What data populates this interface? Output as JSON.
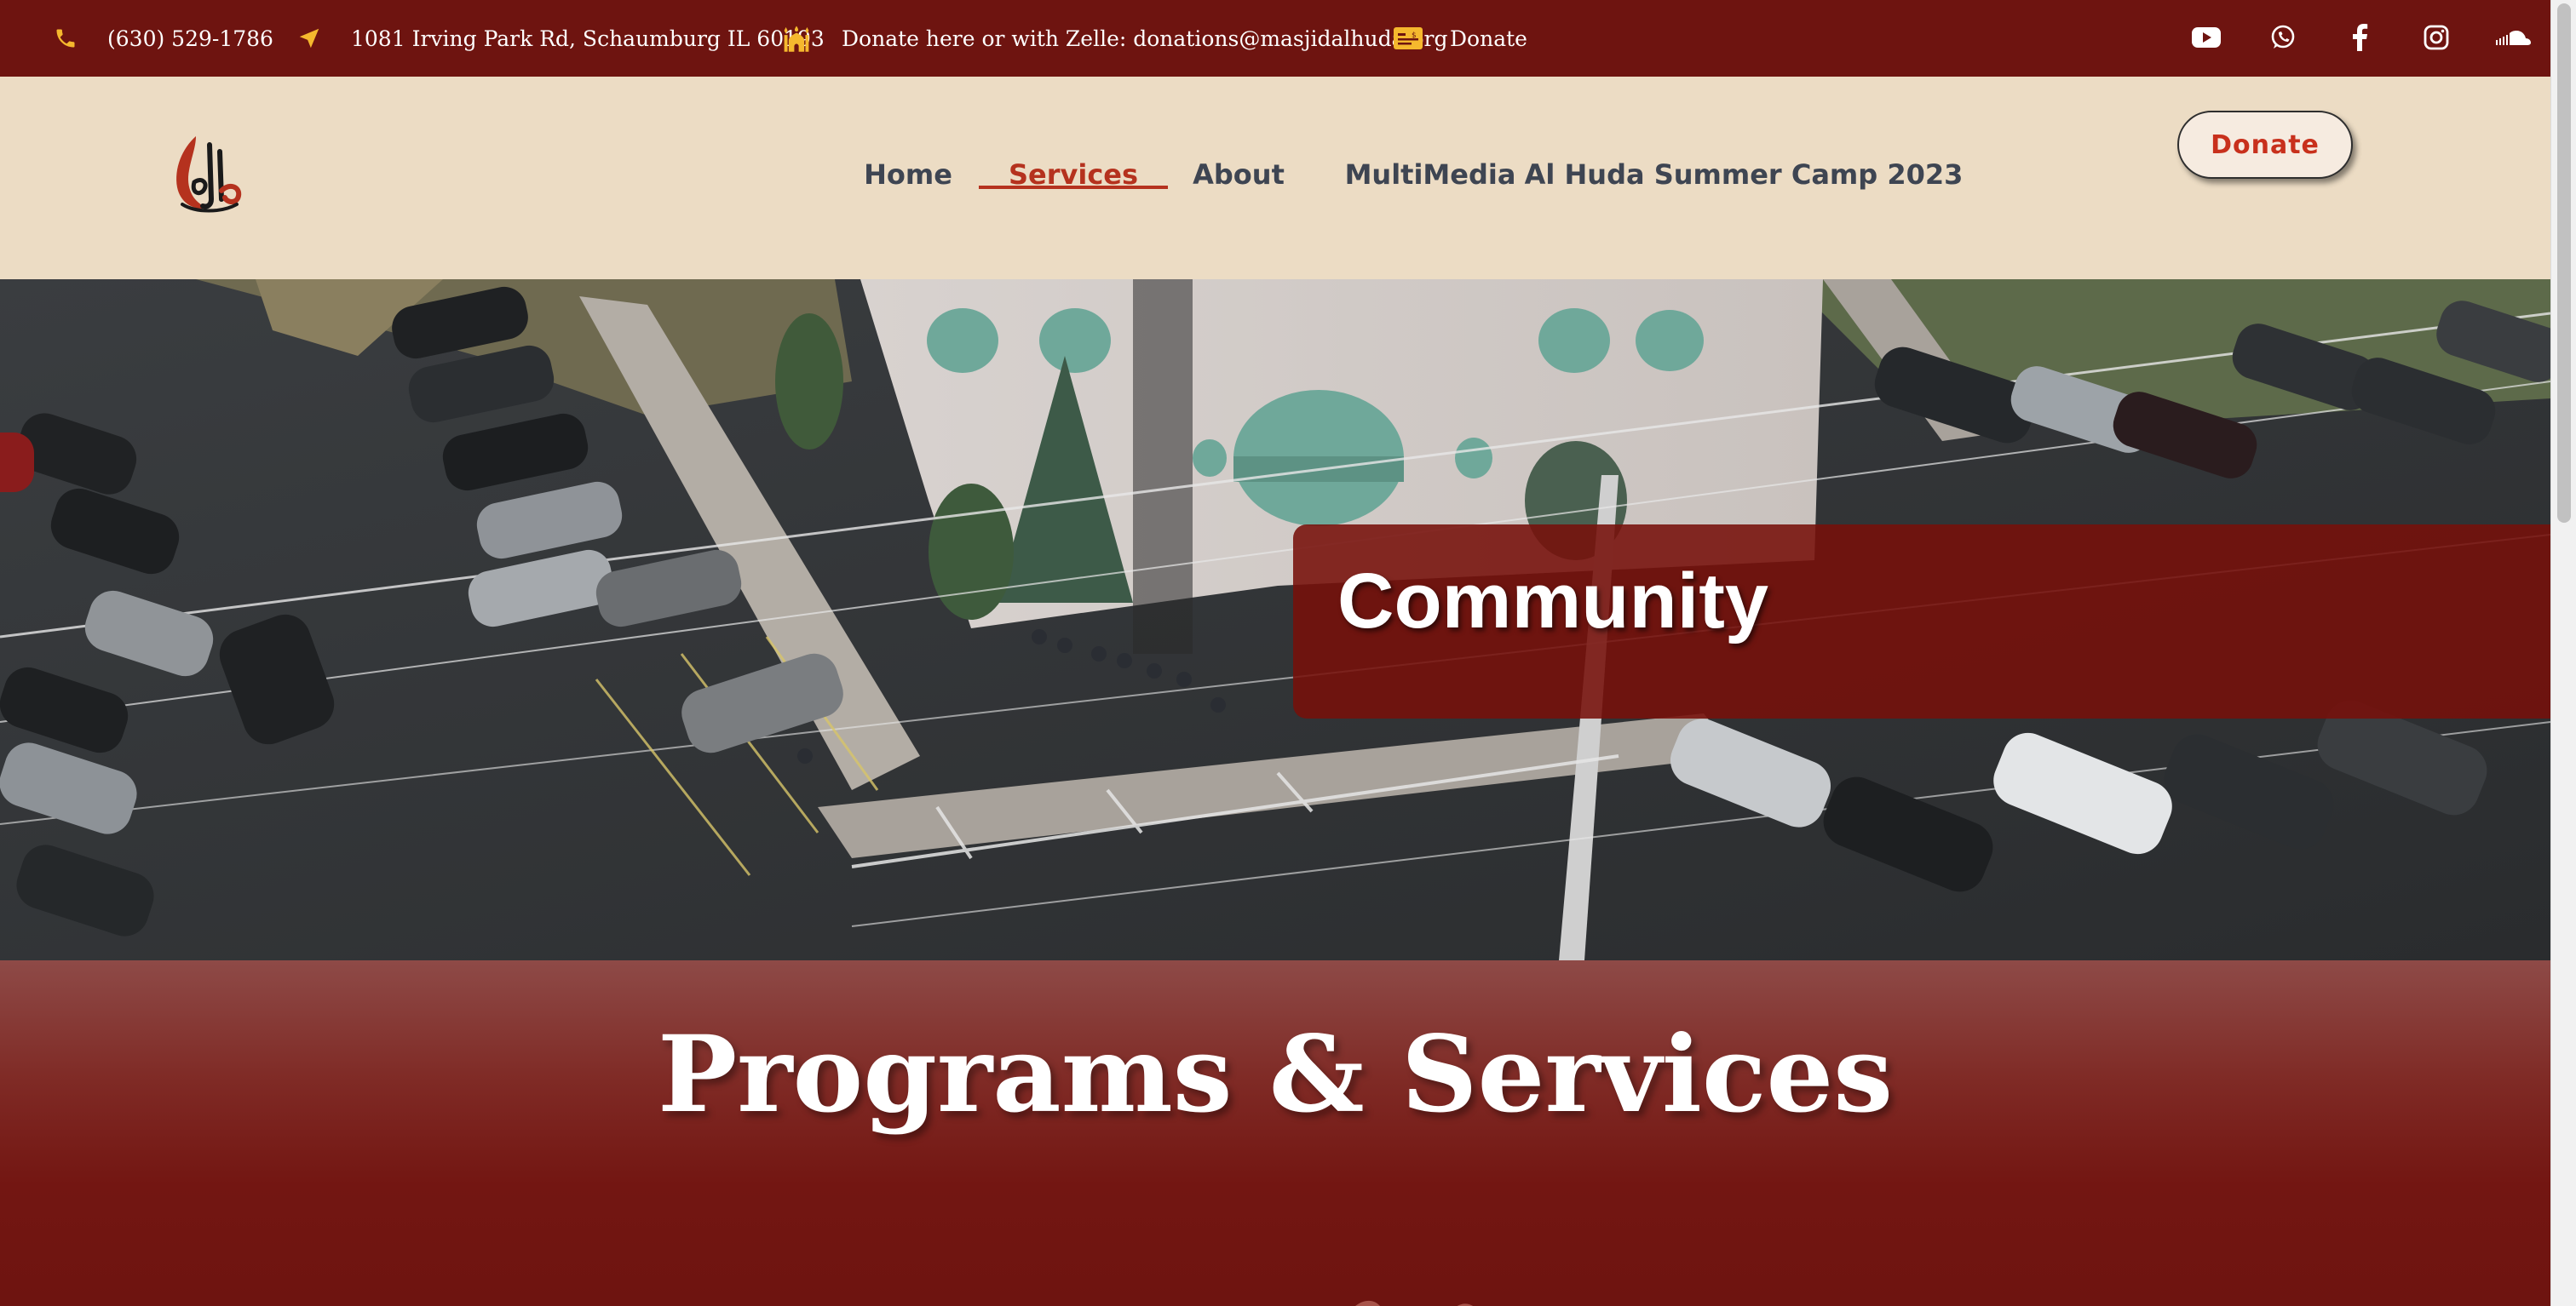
{
  "topbar": {
    "phone": "(630) 529-1786",
    "address": "1081 Irving Park Rd, Schaumburg IL 60193",
    "zelle": "Donate here or with Zelle: donations@masjidalhuda.org",
    "donate_link": "Donate",
    "icons": [
      "phone-icon",
      "location-arrow-icon",
      "mosque-icon",
      "donation-card-icon"
    ],
    "social": [
      "youtube-icon",
      "whatsapp-icon",
      "facebook-icon",
      "instagram-icon",
      "soundcloud-icon"
    ],
    "icon_color": "#f5b82e",
    "background": "#6e1410"
  },
  "nav": {
    "items": [
      "Home",
      "Services",
      "About",
      "MultiMedia",
      "Al Huda Summer Camp 2023"
    ],
    "active": "Services",
    "donate_button": "Donate",
    "background": "#ecdcc4",
    "accent": "#b5321e"
  },
  "hero": {
    "title": "Community",
    "image": "aerial photo of mosque building and parking lot"
  },
  "programs": {
    "title": "Programs & Services"
  }
}
